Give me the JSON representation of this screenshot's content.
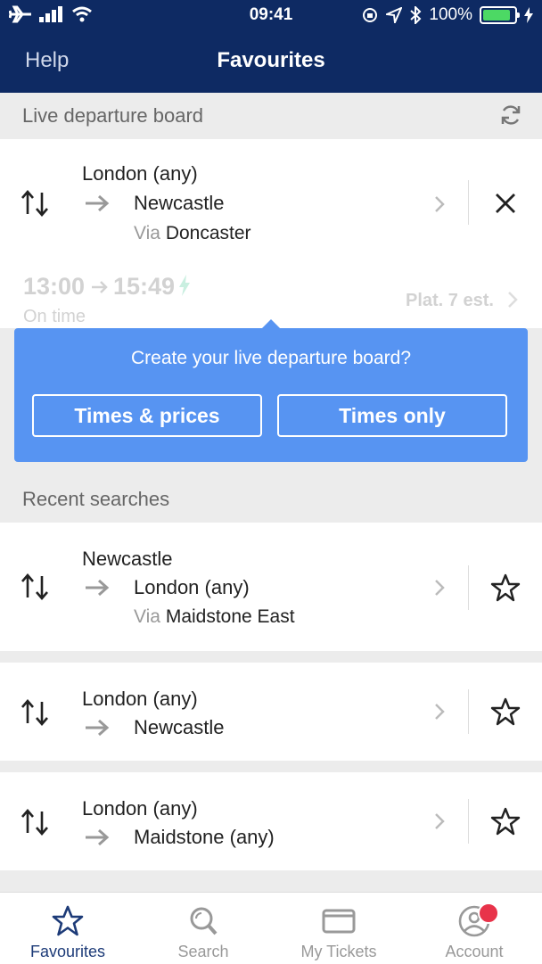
{
  "status": {
    "time": "09:41",
    "battery": "100%"
  },
  "nav": {
    "help": "Help",
    "title": "Favourites"
  },
  "live": {
    "header": "Live departure board",
    "from": "London (any)",
    "to": "Newcastle",
    "via_label": "Via",
    "via": "Doncaster",
    "depart": "13:00",
    "arrive": "15:49",
    "status": "On time",
    "platform": "Plat. 7 est."
  },
  "popup": {
    "prompt": "Create your live departure board?",
    "btn_prices": "Times & prices",
    "btn_times": "Times only"
  },
  "recent": {
    "header": "Recent searches",
    "items": [
      {
        "from": "Newcastle",
        "to": "London (any)",
        "via_label": "Via",
        "via": "Maidstone East"
      },
      {
        "from": "London (any)",
        "to": "Newcastle"
      },
      {
        "from": "London (any)",
        "to": "Maidstone (any)"
      }
    ]
  },
  "tabs": [
    {
      "label": "Favourites",
      "icon": "star-icon"
    },
    {
      "label": "Search",
      "icon": "search-icon"
    },
    {
      "label": "My Tickets",
      "icon": "ticket-icon"
    },
    {
      "label": "Account",
      "icon": "account-icon"
    }
  ],
  "colors": {
    "navy": "#0e2a63",
    "popup": "#5794f2",
    "badge": "#e8334a"
  }
}
